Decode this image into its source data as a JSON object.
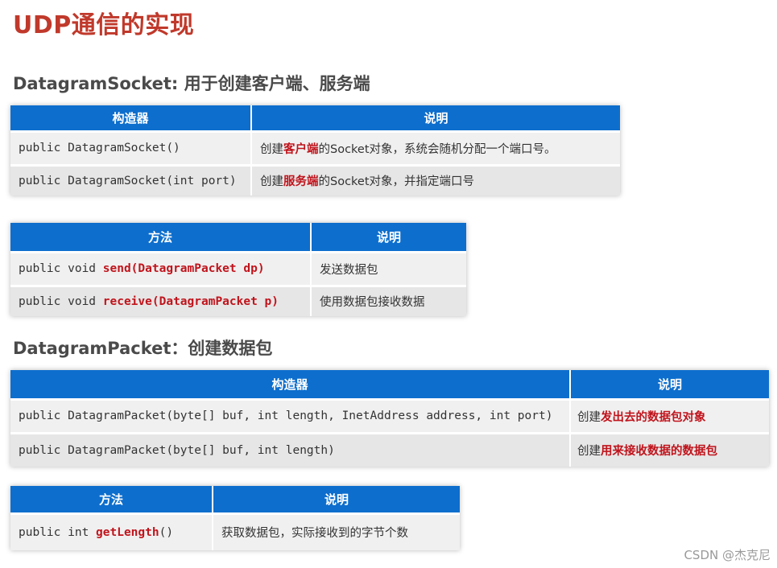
{
  "title": "UDP通信的实现",
  "section1": {
    "heading": "DatagramSocket: 用于创建客户端、服务端",
    "ctor_table": {
      "headers": [
        "构造器",
        "说明"
      ],
      "rows": [
        {
          "code": "public DatagramSocket()",
          "desc_pre": "创建",
          "desc_hl": "客户端",
          "desc_post": "的Socket对象，系统会随机分配一个端口号。"
        },
        {
          "code": "public DatagramSocket(int port)",
          "desc_pre": "创建",
          "desc_hl": "服务端",
          "desc_post": "的Socket对象，并指定端口号"
        }
      ]
    },
    "method_table": {
      "headers": [
        "方法",
        "说明"
      ],
      "rows": [
        {
          "code_pre": "public void ",
          "code_hl": "send(DatagramPacket dp)",
          "desc": "发送数据包"
        },
        {
          "code_pre": "public void ",
          "code_hl": "receive(DatagramPacket p)",
          "desc": "使用数据包接收数据"
        }
      ]
    }
  },
  "section2": {
    "heading": "DatagramPacket：创建数据包",
    "ctor_table": {
      "headers": [
        "构造器",
        "说明"
      ],
      "rows": [
        {
          "code": "public DatagramPacket(byte[] buf, int length, InetAddress address, int port)",
          "desc_pre": "创建",
          "desc_hl": "发出去的数据包对象"
        },
        {
          "code": "public DatagramPacket(byte[] buf, int length)",
          "desc_pre": "创建",
          "desc_hl": "用来接收数据的数据包"
        }
      ]
    },
    "method_table": {
      "headers": [
        "方法",
        "说明"
      ],
      "rows": [
        {
          "code_pre": "public int ",
          "code_hl": "getLength",
          "code_post": "()",
          "desc": "获取数据包，实际接收到的字节个数"
        }
      ]
    }
  },
  "watermark": "CSDN @杰克尼"
}
